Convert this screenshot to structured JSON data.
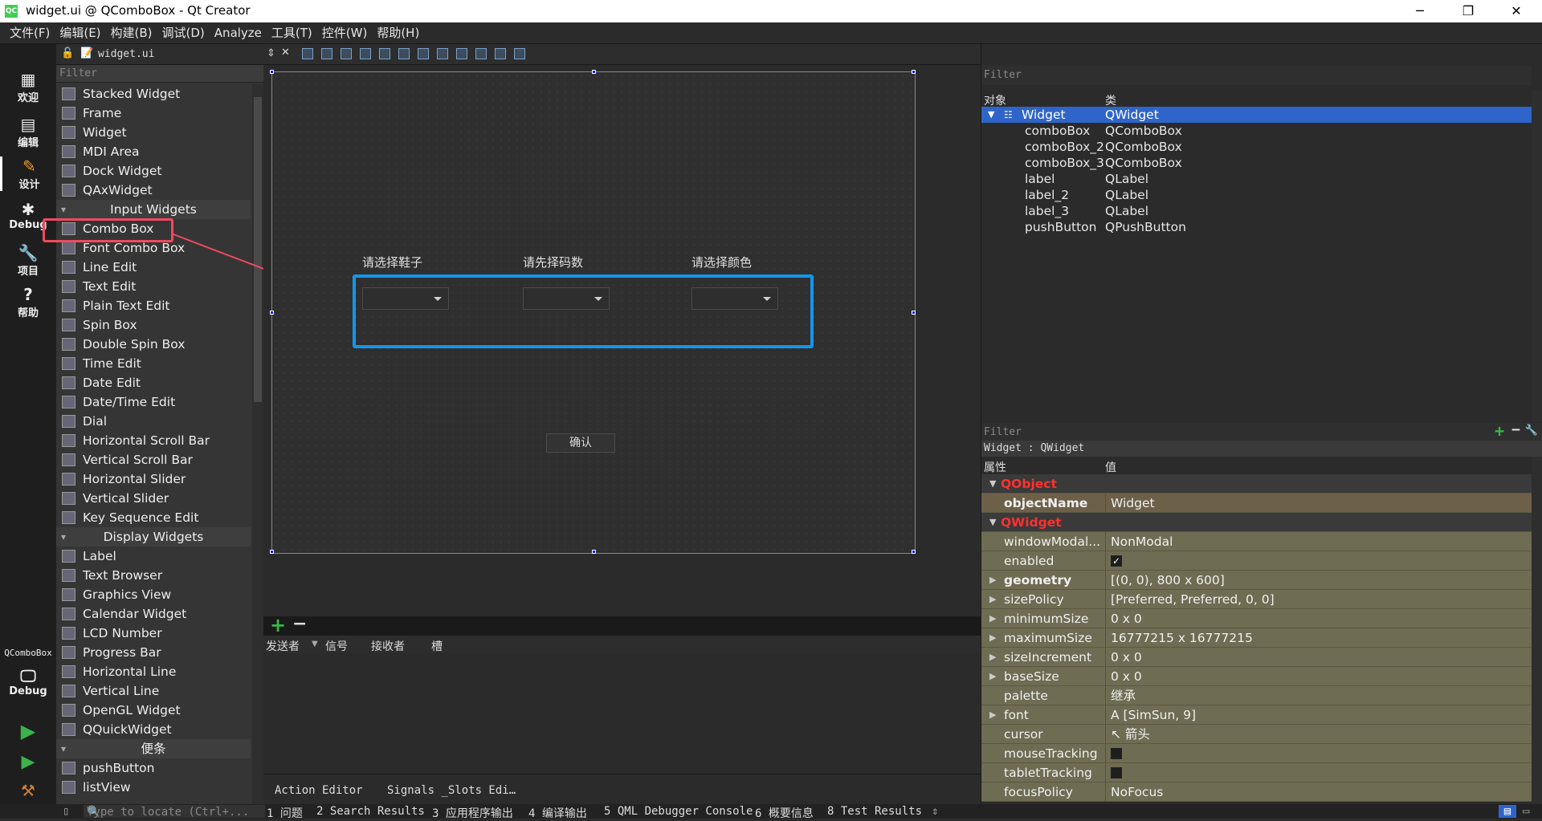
{
  "window": {
    "title": "widget.ui @ QComboBox - Qt Creator",
    "app_icon": "QC",
    "minimize": "─",
    "maximize": "❐",
    "close": "✕"
  },
  "menu": [
    "文件(F)",
    "编辑(E)",
    "构建(B)",
    "调试(D)",
    "Analyze",
    "工具(T)",
    "控件(W)",
    "帮助(H)"
  ],
  "modes": [
    {
      "label": "欢迎",
      "icon": "grid-icon"
    },
    {
      "label": "编辑",
      "icon": "document-icon"
    },
    {
      "label": "设计",
      "icon": "pencil-icon"
    },
    {
      "label": "Debug",
      "icon": "bug-icon"
    },
    {
      "label": "项目",
      "icon": "wrench-icon"
    },
    {
      "label": "帮助",
      "icon": "help-icon"
    }
  ],
  "kit": {
    "name": "QComboBox",
    "label": "Debug"
  },
  "file_tab": "widget.ui",
  "left_filter": "Filter",
  "widget_box": [
    {
      "type": "item",
      "label": "Stacked Widget"
    },
    {
      "type": "item",
      "label": "Frame"
    },
    {
      "type": "item",
      "label": "Widget"
    },
    {
      "type": "item",
      "label": "MDI Area"
    },
    {
      "type": "item",
      "label": "Dock Widget"
    },
    {
      "type": "item",
      "label": "QAxWidget"
    },
    {
      "type": "cat",
      "label": "Input Widgets"
    },
    {
      "type": "item",
      "label": "Combo Box"
    },
    {
      "type": "item",
      "label": "Font Combo Box"
    },
    {
      "type": "item",
      "label": "Line Edit"
    },
    {
      "type": "item",
      "label": "Text Edit"
    },
    {
      "type": "item",
      "label": "Plain Text Edit"
    },
    {
      "type": "item",
      "label": "Spin Box"
    },
    {
      "type": "item",
      "label": "Double Spin Box"
    },
    {
      "type": "item",
      "label": "Time Edit"
    },
    {
      "type": "item",
      "label": "Date Edit"
    },
    {
      "type": "item",
      "label": "Date/Time Edit"
    },
    {
      "type": "item",
      "label": "Dial"
    },
    {
      "type": "item",
      "label": "Horizontal Scroll Bar"
    },
    {
      "type": "item",
      "label": "Vertical Scroll Bar"
    },
    {
      "type": "item",
      "label": "Horizontal Slider"
    },
    {
      "type": "item",
      "label": "Vertical Slider"
    },
    {
      "type": "item",
      "label": "Key Sequence Edit"
    },
    {
      "type": "cat",
      "label": "Display Widgets"
    },
    {
      "type": "item",
      "label": "Label"
    },
    {
      "type": "item",
      "label": "Text Browser"
    },
    {
      "type": "item",
      "label": "Graphics View"
    },
    {
      "type": "item",
      "label": "Calendar Widget"
    },
    {
      "type": "item",
      "label": "LCD Number"
    },
    {
      "type": "item",
      "label": "Progress Bar"
    },
    {
      "type": "item",
      "label": "Horizontal Line"
    },
    {
      "type": "item",
      "label": "Vertical Line"
    },
    {
      "type": "item",
      "label": "OpenGL Widget"
    },
    {
      "type": "item",
      "label": "QQuickWidget"
    },
    {
      "type": "cat",
      "label": "便条"
    },
    {
      "type": "item",
      "label": "pushButton"
    },
    {
      "type": "item",
      "label": "listView"
    }
  ],
  "form": {
    "label1": "请选择鞋子",
    "label2": "请先择码数",
    "label3": "请选择颜色",
    "button": "确认"
  },
  "signal_editor": {
    "add": "+",
    "remove": "−",
    "headers": [
      "发送者",
      "信号",
      "接收者",
      "槽"
    ]
  },
  "center_tabs": [
    "Action Editor",
    "Signals _Slots Edi…"
  ],
  "object_inspector": {
    "filter": "Filter",
    "headers": [
      "对象",
      "类"
    ],
    "rows": [
      {
        "name": "Widget",
        "class": "QWidget"
      },
      {
        "name": "comboBox",
        "class": "QComboBox"
      },
      {
        "name": "comboBox_2",
        "class": "QComboBox"
      },
      {
        "name": "comboBox_3",
        "class": "QComboBox"
      },
      {
        "name": "label",
        "class": "QLabel"
      },
      {
        "name": "label_2",
        "class": "QLabel"
      },
      {
        "name": "label_3",
        "class": "QLabel"
      },
      {
        "name": "pushButton",
        "class": "QPushButton"
      }
    ]
  },
  "property_editor": {
    "filter": "Filter",
    "info": "Widget : QWidget",
    "headers": [
      "属性",
      "值"
    ],
    "rows": [
      {
        "kind": "group",
        "name": "QObject"
      },
      {
        "kind": "prop",
        "name": "objectName",
        "value": "Widget",
        "bold": true,
        "dark": true
      },
      {
        "kind": "group",
        "name": "QWidget"
      },
      {
        "kind": "prop",
        "name": "windowModal...",
        "value": "NonModal"
      },
      {
        "kind": "check",
        "name": "enabled",
        "value": "✓"
      },
      {
        "kind": "prop",
        "name": "geometry",
        "value": "[(0, 0), 800 x 600]",
        "bold": true,
        "exp": true
      },
      {
        "kind": "prop",
        "name": "sizePolicy",
        "value": "[Preferred, Preferred, 0, 0]",
        "exp": true
      },
      {
        "kind": "prop",
        "name": "minimumSize",
        "value": "0 x 0",
        "exp": true
      },
      {
        "kind": "prop",
        "name": "maximumSize",
        "value": "16777215 x 16777215",
        "exp": true
      },
      {
        "kind": "prop",
        "name": "sizeIncrement",
        "value": "0 x 0",
        "exp": true
      },
      {
        "kind": "prop",
        "name": "baseSize",
        "value": "0 x 0",
        "exp": true
      },
      {
        "kind": "prop",
        "name": "palette",
        "value": "继承"
      },
      {
        "kind": "prop",
        "name": "font",
        "value": "A  [SimSun, 9]",
        "exp": true
      },
      {
        "kind": "prop",
        "name": "cursor",
        "value": "↖  箭头"
      },
      {
        "kind": "check",
        "name": "mouseTracking",
        "value": ""
      },
      {
        "kind": "check",
        "name": "tabletTracking",
        "value": ""
      },
      {
        "kind": "prop",
        "name": "focusPolicy",
        "value": "NoFocus"
      }
    ]
  },
  "statusbar": {
    "locate": "Type to locate (Ctrl+...",
    "items": [
      "1 问题",
      "2 Search Results",
      "3 应用程序输出",
      "4 编译输出",
      "5 QML Debugger Console",
      "6 概要信息",
      "8 Test Results"
    ]
  },
  "colors": {
    "accent_blue": "#1596ea",
    "highlight_red": "#ef4a5d",
    "selection": "#2f65ca",
    "prop_bg": "#6e6c52"
  }
}
